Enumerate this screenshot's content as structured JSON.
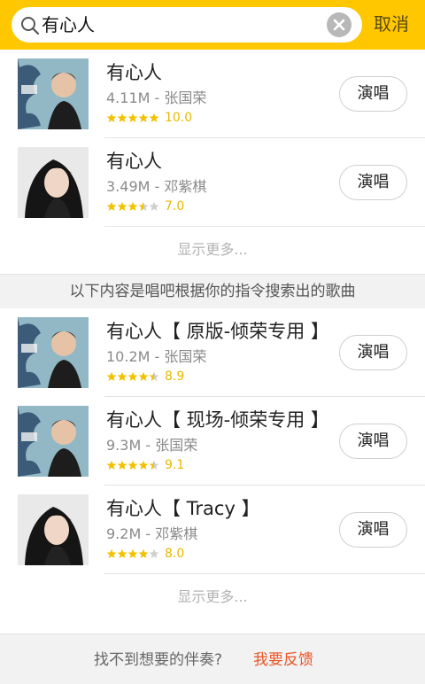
{
  "search": {
    "query": "有心人",
    "cancel_label": "取消"
  },
  "top_results": [
    {
      "title": "有心人",
      "meta": "4.11M - 张国荣",
      "rating": "10.0",
      "stars": 5,
      "artist_cover": "leslie",
      "action": "演唱"
    },
    {
      "title": "有心人",
      "meta": "3.49M - 邓紫棋",
      "rating": "7.0",
      "stars": 3.5,
      "artist_cover": "gem",
      "action": "演唱"
    }
  ],
  "show_more_label": "显示更多...",
  "section_label": "以下内容是唱吧根据你的指令搜索出的歌曲",
  "more_results": [
    {
      "title": "有心人【 原版-倾荣专用 】",
      "meta": "10.2M - 张国荣",
      "rating": "8.9",
      "stars": 4.5,
      "artist_cover": "leslie",
      "action": "演唱"
    },
    {
      "title": "有心人【 现场-倾荣专用 】",
      "meta": "9.3M - 张国荣",
      "rating": "9.1",
      "stars": 4.5,
      "artist_cover": "leslie",
      "action": "演唱"
    },
    {
      "title": "有心人【 Tracy 】",
      "meta": "9.2M - 邓紫棋",
      "rating": "8.0",
      "stars": 4,
      "artist_cover": "gem",
      "action": "演唱"
    }
  ],
  "footer": {
    "prompt": "找不到想要的伴奏?",
    "feedback_label": "我要反馈"
  },
  "colors": {
    "brand_yellow": "#ffc700",
    "star_gold": "#f2c200",
    "feedback_red": "#e8562a"
  }
}
